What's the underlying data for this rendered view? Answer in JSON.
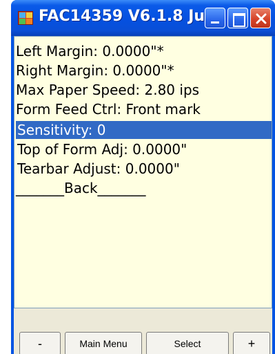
{
  "window": {
    "title": "FAC14359 V6.1.8 Ju..."
  },
  "menu": {
    "items": [
      {
        "label": "Left Margin: 0.0000\"*"
      },
      {
        "label": "Right Margin: 0.0000\"*"
      },
      {
        "label": "Max Paper Speed: 2.80 ips"
      },
      {
        "label": "Form Feed Ctrl: Front mark"
      },
      {
        "label": "Sensitivity: 0"
      },
      {
        "label": "Top of Form Adj: 0.0000\""
      },
      {
        "label": "Tearbar Adjust: 0.0000\""
      },
      {
        "label": "_______Back_______"
      }
    ],
    "selected_index": 4
  },
  "softkeys": {
    "minus": "-",
    "main_menu": "Main Menu",
    "select": "Select",
    "plus": "+"
  },
  "colors": {
    "titlebar": "#0a5ae8",
    "content_background": "#ffffe1",
    "selection": "#316ac5",
    "close_button": "#d6442a"
  }
}
